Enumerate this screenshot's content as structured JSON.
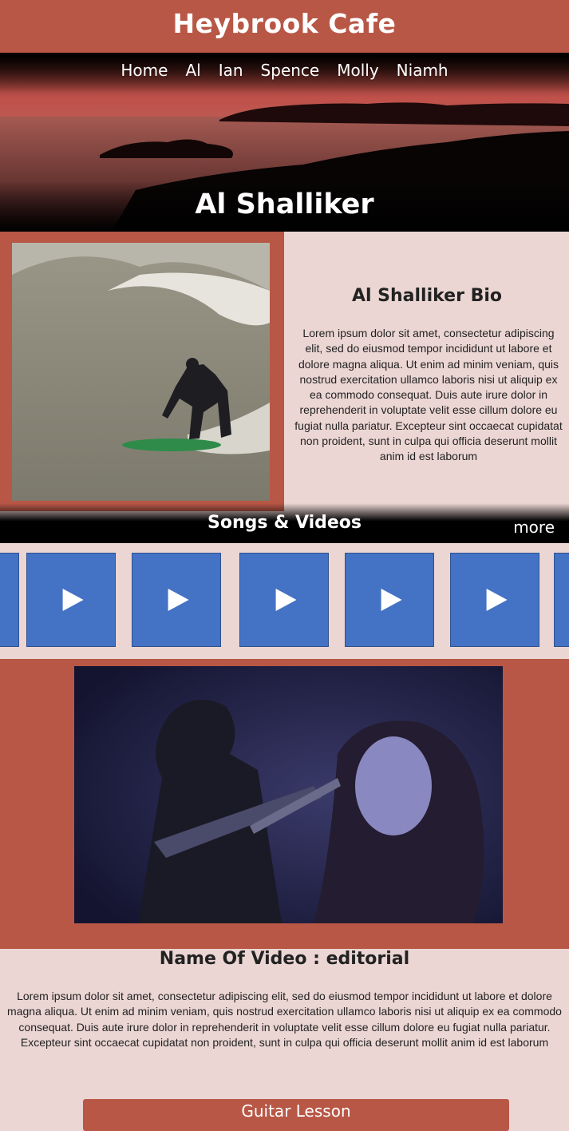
{
  "site": {
    "title": "Heybrook Cafe"
  },
  "nav": {
    "items": [
      {
        "label": "Home"
      },
      {
        "label": "Al"
      },
      {
        "label": "Ian"
      },
      {
        "label": "Spence"
      },
      {
        "label": "Molly"
      },
      {
        "label": "Niamh"
      }
    ]
  },
  "hero": {
    "artist_name": "Al Shalliker"
  },
  "bio": {
    "heading": "Al Shalliker Bio",
    "text": "Lorem ipsum dolor sit amet, consectetur adipiscing elit, sed do eiusmod tempor incididunt ut labore et dolore magna aliqua. Ut enim ad minim veniam, quis nostrud exercitation ullamco laboris nisi ut aliquip ex ea commodo consequat. Duis aute irure dolor in reprehenderit in voluptate velit esse cillum dolore eu fugiat nulla pariatur. Excepteur sint occaecat cupidatat non proident, sunt in culpa qui officia deserunt mollit anim id est laborum"
  },
  "songs": {
    "title": "Songs & Videos",
    "more_label": "more"
  },
  "video": {
    "title": "Name Of Video : editorial",
    "description": "Lorem ipsum dolor sit amet, consectetur adipiscing elit, sed do eiusmod tempor incididunt ut labore et dolore magna aliqua. Ut enim ad minim veniam, quis nostrud exercitation ullamco laboris nisi ut aliquip ex ea commodo consequat. Duis aute irure dolor in reprehenderit in voluptate velit esse cillum dolore eu fugiat nulla pariatur. Excepteur sint occaecat cupidatat non proident, sunt in culpa qui officia deserunt mollit anim id est laborum"
  },
  "lesson": {
    "button_label": "Guitar Lesson"
  },
  "colors": {
    "accent": "#b85746",
    "background": "#ebd6d3",
    "thumbnail": "#4472c4"
  },
  "icons": {
    "play": "play-icon"
  }
}
